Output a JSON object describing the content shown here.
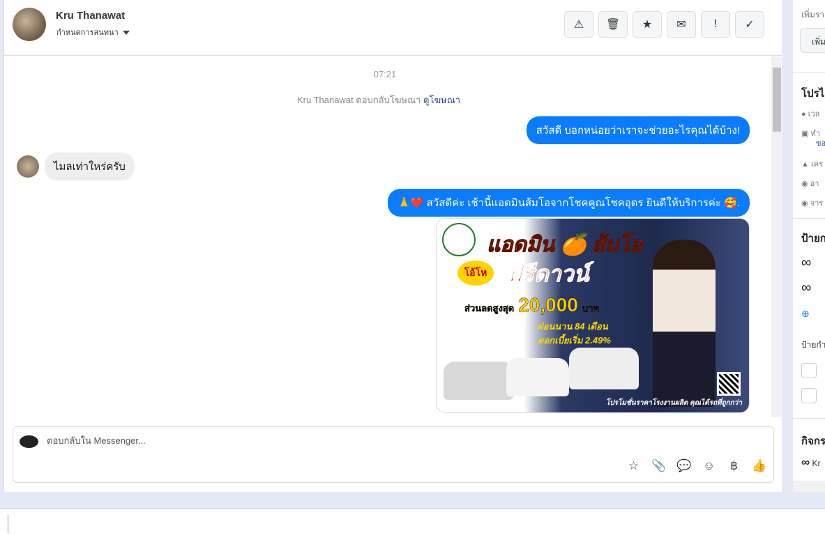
{
  "header": {
    "name": "Kru Thanawat",
    "assign_label": "กำหนดการสนทนา",
    "toolbar": [
      {
        "name": "spam-button",
        "glyph": "⚠"
      },
      {
        "name": "delete-button",
        "glyph": "🗑"
      },
      {
        "name": "star-button",
        "glyph": "★"
      },
      {
        "name": "mark-unread-button",
        "glyph": "✉"
      },
      {
        "name": "follow-up-button",
        "glyph": "!"
      },
      {
        "name": "done-button",
        "glyph": "✓"
      }
    ]
  },
  "chat": {
    "time": "07:21",
    "system_text": "Kru Thanawat ตอบกลับโฆษณา",
    "system_link": "ดูโฆษณา",
    "messages": [
      {
        "from": "page",
        "text": "สวัสดี บอกหน่อยว่าเราจะช่วยอะไรคุณได้บ้าง!"
      },
      {
        "from": "user",
        "text": "ไมลเท่าใหร่ครับ"
      },
      {
        "from": "page",
        "text": "🙏❤️ สวัสดีค่ะ เช้านี้แอดมินส้มโอจากโชคคูณโชคอุดร ยินดีให้บริการค่ะ 🥰."
      }
    ],
    "poster": {
      "title": "แอดมิน 🍊 ส้มโอ",
      "wow": "โอ้โห",
      "headline": "ฟรีดาวน์",
      "discount_label": "ส่วนลดสูงสุด",
      "discount_amount": "20,000",
      "currency": "บาท",
      "installment": "ผ่อนนาน 84 เดือน",
      "interest": "ดอกเบี้ยเริ่ม 2.49%",
      "footer": "โปรโมชั่นราคาโรงงานผลิต คุณได้รถที่ถูกกว่า"
    }
  },
  "composer": {
    "placeholder": "ตอบกลับใน Messenger...",
    "icons": [
      "saved-reply-icon",
      "attachment-icon",
      "message-icon",
      "emoji-icon",
      "baht-icon",
      "like-icon"
    ],
    "glyphs": [
      "☆",
      "📎",
      "💬",
      "☺",
      "฿",
      "👍"
    ]
  },
  "right": {
    "top_text": "เพิ่มรา",
    "top_button": "เพิ่ม",
    "profile_title": "โปรไ",
    "rows": [
      "เวล",
      "ทำ",
      "ขอ",
      "เคร",
      "อา",
      "จาร"
    ],
    "labels_title": "ป้ายก",
    "label_sub": "ป้ายกำ",
    "activity_title": "กิจกร",
    "activity_row": "Kr"
  }
}
